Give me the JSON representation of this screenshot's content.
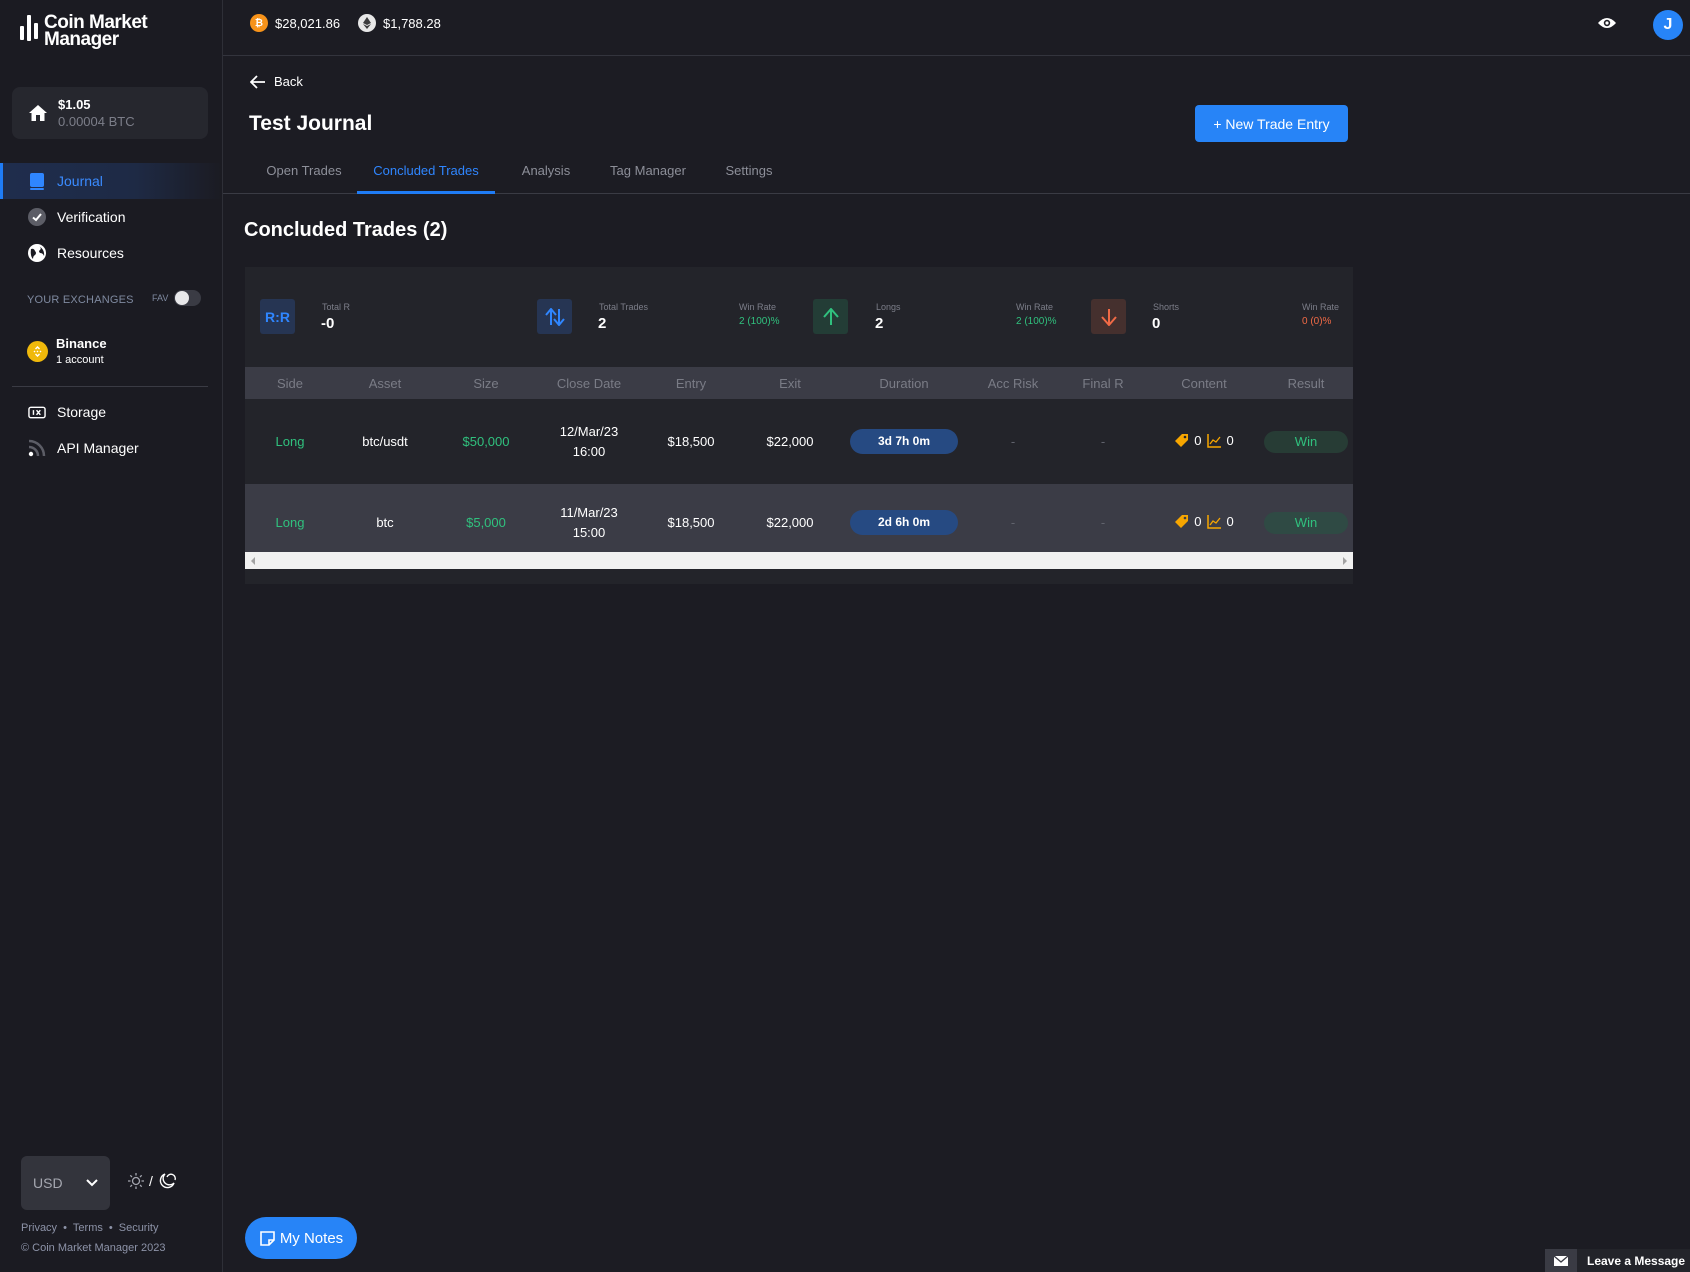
{
  "app": {
    "logo_line1": "Coin Market",
    "logo_line2": "Manager"
  },
  "balance": {
    "usd": "$1.05",
    "btc": "0.00004 BTC"
  },
  "sidebar": {
    "nav": [
      {
        "label": "Journal",
        "icon": "book-icon",
        "active": true
      },
      {
        "label": "Verification",
        "icon": "check-circle-icon"
      },
      {
        "label": "Resources",
        "icon": "globe-icon"
      }
    ],
    "exchanges_label": "YOUR EXCHANGES",
    "fav_label": "FAV",
    "fav_enabled": false,
    "exchanges": [
      {
        "name": "Binance",
        "sub": "1 account",
        "icon": "binance-icon"
      }
    ],
    "nav2": [
      {
        "label": "Storage",
        "icon": "storage-icon"
      },
      {
        "label": "API Manager",
        "icon": "rss-icon"
      }
    ],
    "currency": "USD",
    "theme_separator": "/",
    "footer_links": [
      "Privacy",
      "Terms",
      "Security"
    ],
    "copyright": "© Coin Market Manager 2023"
  },
  "topbar": {
    "tickers": [
      {
        "symbol": "BTC",
        "icon": "bitcoin-icon",
        "price": "$28,021.86",
        "color": "#f7931a"
      },
      {
        "symbol": "ETH",
        "icon": "ethereum-icon",
        "price": "$1,788.28",
        "color": "#e8e8e8"
      }
    ],
    "avatar_initial": "J"
  },
  "page": {
    "back_label": "Back",
    "title": "Test Journal",
    "new_trade_label": "+ New Trade Entry",
    "tabs": [
      {
        "label": "Open Trades"
      },
      {
        "label": "Concluded Trades",
        "active": true
      },
      {
        "label": "Analysis"
      },
      {
        "label": "Tag Manager"
      },
      {
        "label": "Settings"
      }
    ],
    "section_title": "Concluded Trades (2)"
  },
  "stats": {
    "rr": {
      "icon_text": "R:R",
      "label": "Total R",
      "value": "-0"
    },
    "total": {
      "label": "Total Trades",
      "value": "2",
      "rate_label": "Win Rate",
      "rate": "2 (100)%"
    },
    "longs": {
      "label": "Longs",
      "value": "2",
      "rate_label": "Win Rate",
      "rate": "2 (100)%"
    },
    "shorts": {
      "label": "Shorts",
      "value": "0",
      "rate_label": "Win Rate",
      "rate": "0 (0)%"
    }
  },
  "table": {
    "columns": [
      "Side",
      "Asset",
      "Size",
      "Close Date",
      "Entry",
      "Exit",
      "Duration",
      "Acc Risk",
      "Final R",
      "Content",
      "Result"
    ],
    "rows": [
      {
        "side": "Long",
        "asset": "btc/usdt",
        "size": "$50,000",
        "close_date": "12/Mar/23",
        "close_time": "16:00",
        "entry": "$18,500",
        "exit": "$22,000",
        "duration": "3d 7h 0m",
        "acc_risk": "-",
        "final_r": "-",
        "tags": "0",
        "charts": "0",
        "result": "Win"
      },
      {
        "side": "Long",
        "asset": "btc",
        "size": "$5,000",
        "close_date": "11/Mar/23",
        "close_time": "15:00",
        "entry": "$18,500",
        "exit": "$22,000",
        "duration": "2d 6h 0m",
        "acc_risk": "-",
        "final_r": "-",
        "tags": "0",
        "charts": "0",
        "result": "Win"
      }
    ]
  },
  "notes_label": "My Notes",
  "leave_message_label": "Leave a Message",
  "colors": {
    "accent": "#2784f7",
    "win": "#30c17e",
    "loss": "#f06a46",
    "tag": "#f7a600"
  }
}
